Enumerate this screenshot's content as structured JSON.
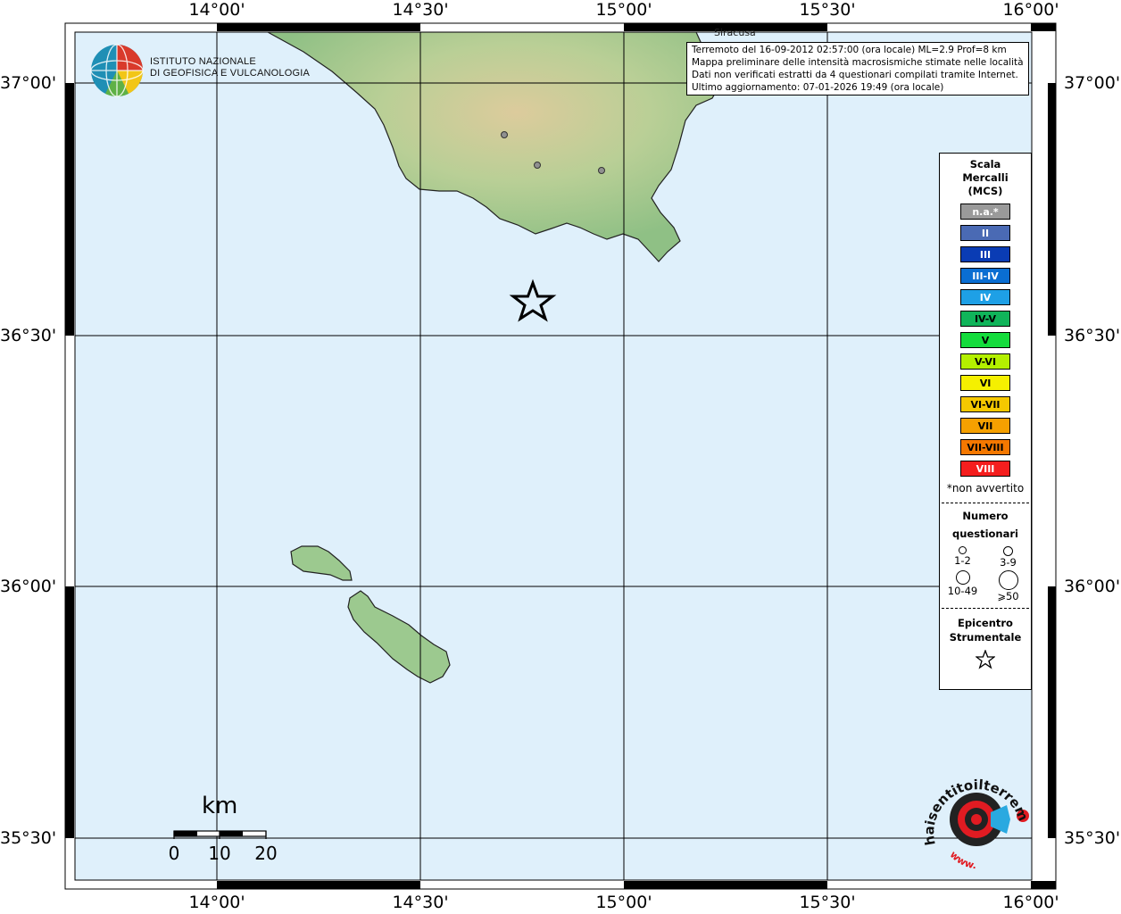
{
  "coords": {
    "lon_labels": [
      "14°00'",
      "14°30'",
      "15°00'",
      "15°30'",
      "16°00'"
    ],
    "lat_labels": [
      "37°00'",
      "36°30'",
      "36°00'",
      "35°30'"
    ]
  },
  "info": {
    "line1": "Terremoto del 16-09-2012 02:57:00 (ora locale) ML=2.9 Prof=8 km",
    "line2": "Mappa preliminare delle intensità macrosismiche stimate nelle località",
    "line3": "Dati non verificati estratti da 4 questionari compilati tramite Internet.",
    "line4": "Ultimo aggiornamento: 07-01-2026 19:49 (ora locale)"
  },
  "city": "Siracusa",
  "logo": {
    "line1": "ISTITUTO NAZIONALE",
    "line2": "DI GEOFISICA E VULCANOLOGIA"
  },
  "legend": {
    "title1": "Scala",
    "title2": "Mercalli",
    "title3": "(MCS)",
    "levels": [
      {
        "label": "n.a.*",
        "color": "#9a9a9a",
        "text": "#ffffff"
      },
      {
        "label": "II",
        "color": "#4a6ab4",
        "text": "#ffffff"
      },
      {
        "label": "III",
        "color": "#0a3cb4",
        "text": "#ffffff"
      },
      {
        "label": "III-IV",
        "color": "#0a6ed2",
        "text": "#ffffff"
      },
      {
        "label": "IV",
        "color": "#1ea0e6",
        "text": "#ffffff"
      },
      {
        "label": "IV-V",
        "color": "#10b45a",
        "text": "#000000"
      },
      {
        "label": "V",
        "color": "#14dc3c",
        "text": "#000000"
      },
      {
        "label": "V-VI",
        "color": "#b4f000",
        "text": "#000000"
      },
      {
        "label": "VI",
        "color": "#f5f000",
        "text": "#000000"
      },
      {
        "label": "VI-VII",
        "color": "#f5c800",
        "text": "#000000"
      },
      {
        "label": "VII",
        "color": "#f5a000",
        "text": "#000000"
      },
      {
        "label": "VII-VIII",
        "color": "#f57800",
        "text": "#000000"
      },
      {
        "label": "VIII",
        "color": "#f51e1e",
        "text": "#ffffff"
      }
    ],
    "not_felt_note": "*non avvertito",
    "count_title1": "Numero",
    "count_title2": "questionari",
    "count_classes": [
      "1-2",
      "3-9",
      "10-49",
      "⩾50"
    ],
    "epicenter_title1": "Epicentro",
    "epicenter_title2": "Strumentale"
  },
  "scale": {
    "unit": "km",
    "ticks": [
      "0",
      "10",
      "20"
    ]
  },
  "colors": {
    "sea": "#dff0fb",
    "land": "#9cc98f",
    "highland": "#d8c99a",
    "grid": "#000000",
    "localities": "#909090"
  },
  "hsit": {
    "text": "haisentitoilterremoto.it",
    "www": "www."
  },
  "map_features": {
    "epicenter_icon": "star-icon",
    "locality_count": 3
  }
}
